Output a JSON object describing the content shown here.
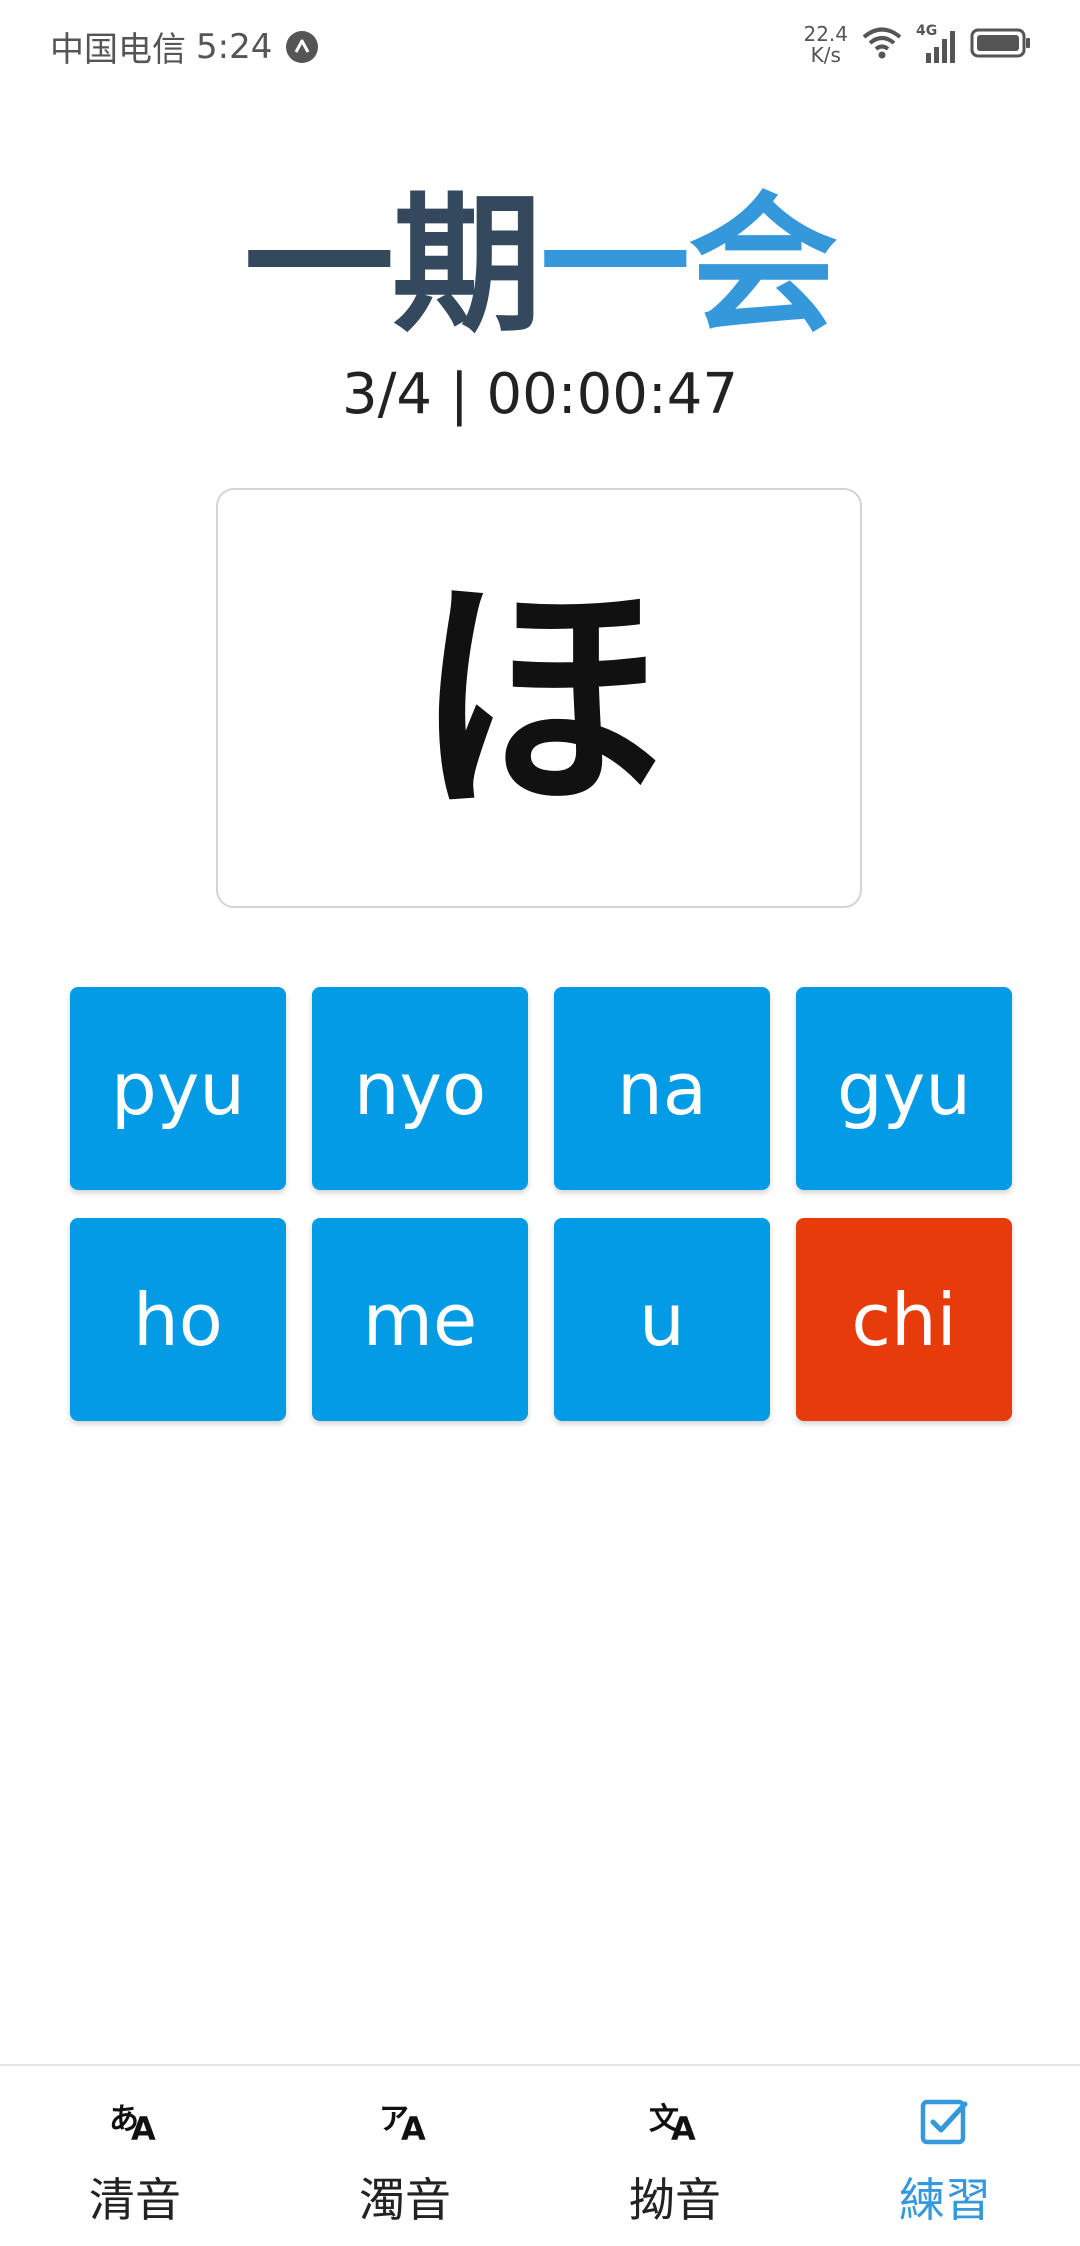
{
  "status_bar": {
    "carrier": "中国电信",
    "time": "5:24",
    "net_speed_value": "22.4",
    "net_speed_unit": "K/s",
    "network_type": "4G",
    "icons": [
      "navigation-badge-icon",
      "wifi-icon",
      "signal-icon",
      "battery-icon"
    ]
  },
  "title": {
    "part_a": "一期",
    "part_b": "一会",
    "colors": {
      "part_a": "#34495e",
      "part_b": "#3498db"
    }
  },
  "progress": {
    "text": "3/4 | 00:00:47"
  },
  "card": {
    "kana": "ほ"
  },
  "answers": [
    {
      "label": "pyu",
      "state": "default"
    },
    {
      "label": "nyo",
      "state": "default"
    },
    {
      "label": "na",
      "state": "default"
    },
    {
      "label": "gyu",
      "state": "default"
    },
    {
      "label": "ho",
      "state": "default"
    },
    {
      "label": "me",
      "state": "default"
    },
    {
      "label": "u",
      "state": "default"
    },
    {
      "label": "chi",
      "state": "wrong"
    }
  ],
  "colors": {
    "button": "#039be5",
    "button_wrong": "#e83b0b",
    "active_tab": "#3498db"
  },
  "bottom_nav": {
    "items": [
      {
        "label": "清音",
        "icon": "hiragana-translate-icon",
        "glyph": "あ",
        "glyph_b": "A"
      },
      {
        "label": "濁音",
        "icon": "katakana-translate-icon",
        "glyph": "ア",
        "glyph_b": "A"
      },
      {
        "label": "拗音",
        "icon": "translate-icon",
        "glyph": "文",
        "glyph_b": "A"
      },
      {
        "label": "練習",
        "icon": "checkbox-icon",
        "active": true
      }
    ]
  }
}
